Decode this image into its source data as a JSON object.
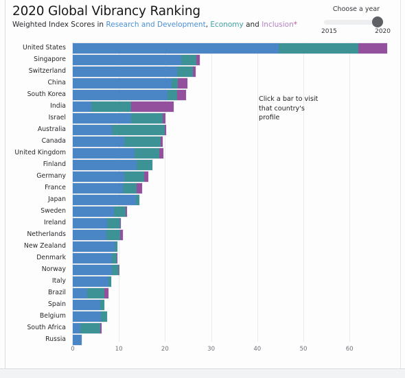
{
  "header": {
    "title": "2020 Global Vibrancy Ranking",
    "subtitle_prefix": "Weighted Index Scores in ",
    "subtitle_rd": "Research and Development",
    "subtitle_sep1": ", ",
    "subtitle_eco": "Economy",
    "subtitle_sep2": " and ",
    "subtitle_inc": "Inclusion",
    "subtitle_star": "*"
  },
  "year_slider": {
    "label": "Choose a year",
    "start_year": "2015",
    "end_year": "2020",
    "selected": "2020"
  },
  "annotation": {
    "line1": "Click a bar to visit",
    "line2": "that country's",
    "line3": "profile"
  },
  "colors": {
    "research_and_development": "#4a86c5",
    "economy": "#3d9295",
    "inclusion": "#93509d",
    "grid": "#e8eaec",
    "background": "#fdfdfd",
    "text": "#25272a"
  },
  "chart_data": {
    "type": "bar",
    "orientation": "horizontal",
    "stacked": true,
    "title": "2020 Global Vibrancy Ranking",
    "subtitle": "Weighted Index Scores in Research and Development, Economy and Inclusion*",
    "xlabel": "",
    "ylabel": "",
    "xlim": [
      0,
      68
    ],
    "xticks": [
      0,
      10,
      20,
      30,
      40,
      50,
      60
    ],
    "grid": true,
    "legend": "inline-subtitle",
    "categories": [
      "United States",
      "Singapore",
      "Switzerland",
      "China",
      "South Korea",
      "India",
      "Israel",
      "Australia",
      "Canada",
      "United Kingdom",
      "Finland",
      "Germany",
      "France",
      "Japan",
      "Sweden",
      "Ireland",
      "Netherlands",
      "New Zealand",
      "Denmark",
      "Norway",
      "Italy",
      "Brazil",
      "Spain",
      "Belgium",
      "South Africa",
      "Russia"
    ],
    "series": [
      {
        "name": "Research and Development",
        "color": "#4a86c5",
        "values": [
          44.6,
          23.5,
          22.6,
          21.4,
          20.6,
          4.0,
          12.6,
          8.5,
          11.2,
          13.4,
          13.8,
          11.2,
          10.9,
          13.7,
          9.0,
          7.4,
          7.3,
          9.1,
          8.5,
          8.5,
          7.7,
          3.1,
          6.0,
          6.1,
          1.6,
          1.9
        ]
      },
      {
        "name": "Economy",
        "color": "#3d9295",
        "values": [
          17.3,
          3.3,
          3.4,
          1.3,
          2.0,
          8.7,
          6.9,
          11.5,
          7.9,
          5.3,
          3.4,
          4.3,
          2.9,
          0.8,
          2.4,
          2.8,
          3.0,
          0.5,
          1.0,
          1.4,
          0.6,
          3.7,
          0.9,
          1.4,
          4.3,
          0.0
        ]
      },
      {
        "name": "Inclusion",
        "color": "#93509d",
        "values": [
          6.3,
          0.7,
          0.7,
          2.1,
          1.9,
          9.2,
          0.6,
          0.3,
          0.4,
          1.0,
          0.0,
          0.8,
          1.2,
          0.0,
          0.3,
          0.2,
          0.5,
          0.0,
          0.1,
          0.1,
          0.0,
          1.0,
          0.0,
          0.0,
          0.3,
          0.0
        ]
      }
    ],
    "totals": [
      68.2,
      27.5,
      26.7,
      24.8,
      24.5,
      21.9,
      20.1,
      20.3,
      19.5,
      19.7,
      17.2,
      16.3,
      15.0,
      14.5,
      11.7,
      10.4,
      10.8,
      9.6,
      9.6,
      10.0,
      8.3,
      7.8,
      6.9,
      7.5,
      6.2,
      1.9
    ]
  }
}
